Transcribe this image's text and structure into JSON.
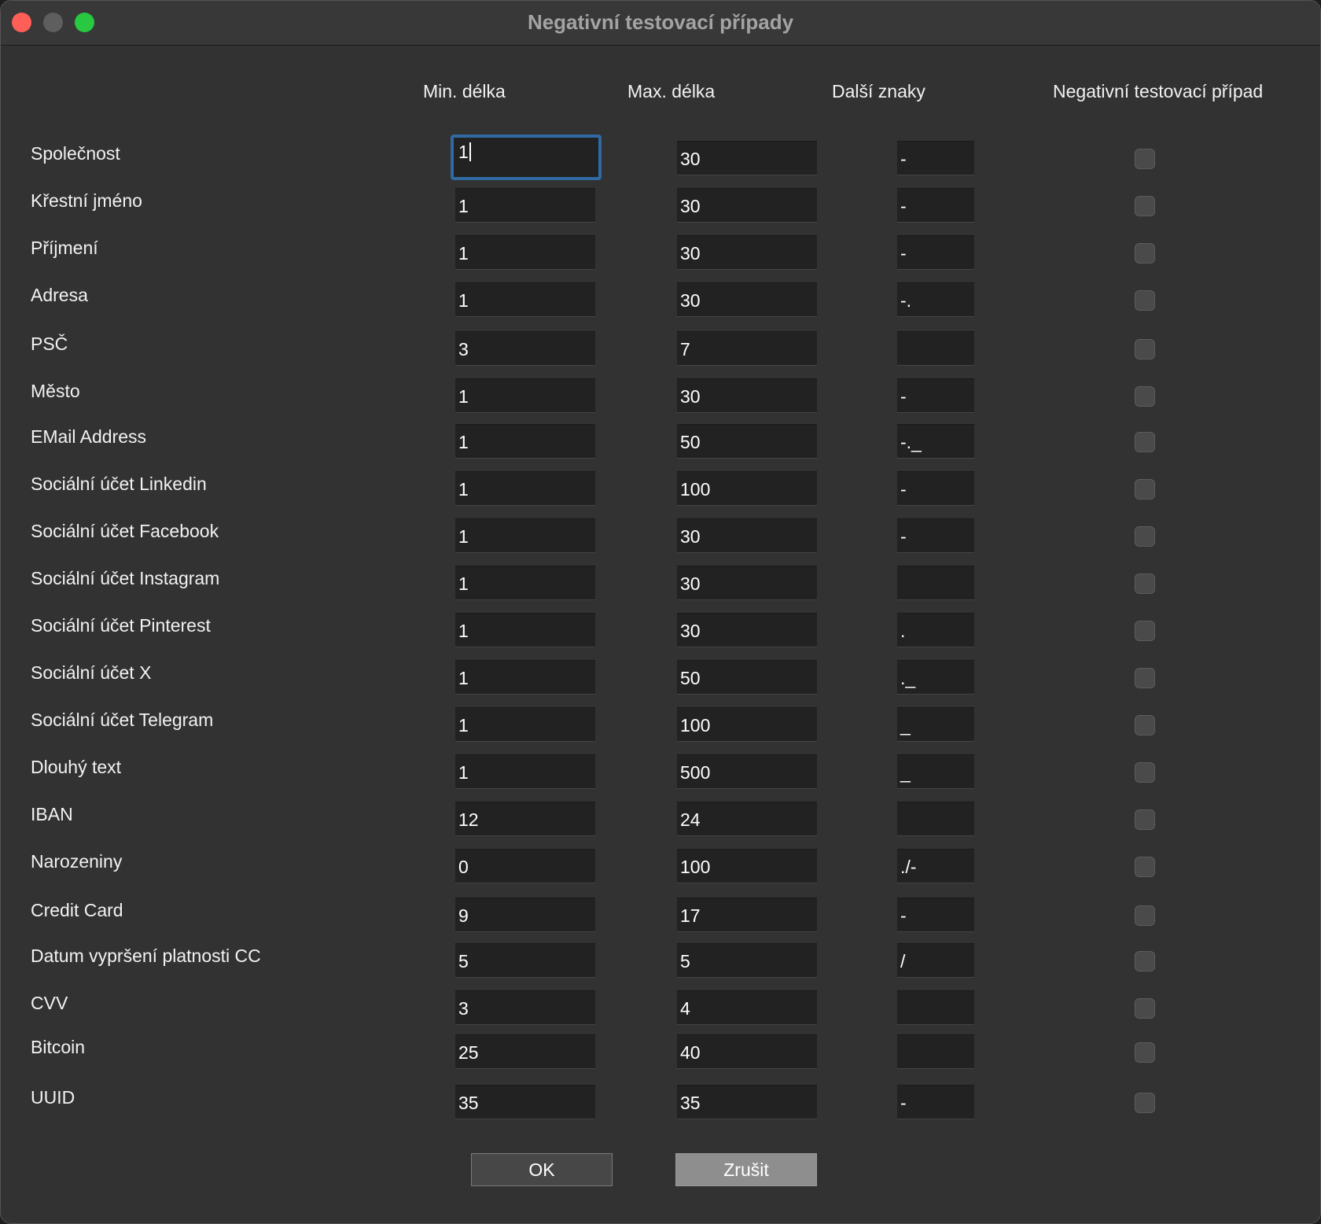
{
  "window": {
    "title": "Negativní testovací případy"
  },
  "headers": {
    "min_length": "Min. délka",
    "max_length": "Max. délka",
    "extra_chars": "Další znaky",
    "negative_case": "Negativní testovací případ"
  },
  "rows": [
    {
      "label": "Společnost",
      "min": "1",
      "max": "30",
      "extra": "-",
      "negative": false
    },
    {
      "label": "Křestní jméno",
      "min": "1",
      "max": "30",
      "extra": "-",
      "negative": false
    },
    {
      "label": "Příjmení",
      "min": "1",
      "max": "30",
      "extra": "-",
      "negative": false
    },
    {
      "label": "Adresa",
      "min": "1",
      "max": "30",
      "extra": "-.",
      "negative": false
    },
    {
      "label": "PSČ",
      "min": "3",
      "max": "7",
      "extra": "",
      "negative": false
    },
    {
      "label": "Město",
      "min": "1",
      "max": "30",
      "extra": "-",
      "negative": false
    },
    {
      "label": "EMail Address",
      "min": "1",
      "max": "50",
      "extra": "-._",
      "negative": false
    },
    {
      "label": "Sociální účet Linkedin",
      "min": "1",
      "max": "100",
      "extra": "-",
      "negative": false
    },
    {
      "label": "Sociální účet Facebook",
      "min": "1",
      "max": "30",
      "extra": "-",
      "negative": false
    },
    {
      "label": "Sociální účet Instagram",
      "min": "1",
      "max": "30",
      "extra": "",
      "negative": false
    },
    {
      "label": "Sociální účet Pinterest",
      "min": "1",
      "max": "30",
      "extra": ".",
      "negative": false
    },
    {
      "label": "Sociální účet X",
      "min": "1",
      "max": "50",
      "extra": "._",
      "negative": false
    },
    {
      "label": "Sociální účet Telegram",
      "min": "1",
      "max": "100",
      "extra": "_",
      "negative": false
    },
    {
      "label": "Dlouhý text",
      "min": "1",
      "max": "500",
      "extra": "_",
      "negative": false
    },
    {
      "label": "IBAN",
      "min": "12",
      "max": "24",
      "extra": "",
      "negative": false
    },
    {
      "label": "Narozeniny",
      "min": "0",
      "max": "100",
      "extra": "./-",
      "negative": false
    },
    {
      "label": "Credit Card",
      "min": "9",
      "max": "17",
      "extra": " -",
      "negative": false
    },
    {
      "label": "Datum vypršení platnosti CC",
      "min": "5",
      "max": "5",
      "extra": "/",
      "negative": false
    },
    {
      "label": "CVV",
      "min": "3",
      "max": "4",
      "extra": "",
      "negative": false
    },
    {
      "label": "Bitcoin",
      "min": "25",
      "max": "40",
      "extra": "",
      "negative": false
    },
    {
      "label": "UUID",
      "min": "35",
      "max": "35",
      "extra": "-",
      "negative": false
    }
  ],
  "buttons": {
    "ok": "OK",
    "cancel": "Zrušit"
  }
}
